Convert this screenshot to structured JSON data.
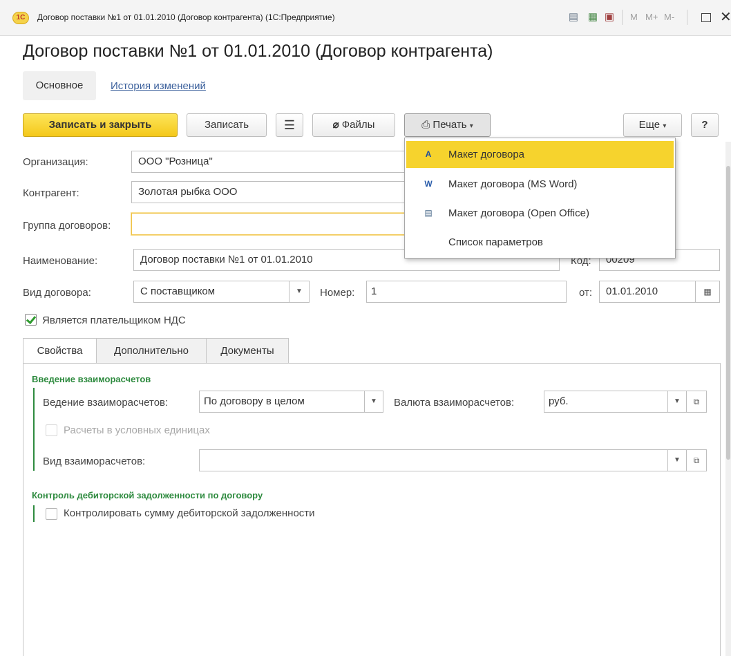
{
  "window": {
    "title": "Договор поставки №1 от 01.01.2010 (Договор контрагента)  (1С:Предприятие)",
    "toolbar_m": [
      "M",
      "M+",
      "M-"
    ]
  },
  "form": {
    "title": "Договор поставки №1 от 01.01.2010 (Договор контрагента)",
    "tabs": {
      "main": "Основное",
      "history": "История изменений"
    }
  },
  "toolbar": {
    "save_close": "Записать и закрыть",
    "save": "Записать",
    "files": "Файлы",
    "print": "Печать",
    "more": "Еще",
    "help": "?"
  },
  "print_menu": {
    "items": [
      {
        "label": "Макет договора",
        "icon": "word-doc-icon"
      },
      {
        "label": "Макет договора (MS Word)",
        "icon": "ms-word-icon"
      },
      {
        "label": "Макет договора (Open Office)",
        "icon": "open-office-icon"
      },
      {
        "label": "Список параметров",
        "icon": ""
      }
    ]
  },
  "fields": {
    "organization": {
      "label": "Организация:",
      "value": "ООО \"Розница\""
    },
    "counterparty": {
      "label": "Контрагент:",
      "value": "Золотая рыбка ООО"
    },
    "group": {
      "label": "Группа договоров:",
      "value": ""
    },
    "name": {
      "label": "Наименование:",
      "value": "Договор поставки №1 от 01.01.2010"
    },
    "code": {
      "label": "Код:",
      "value": "00209"
    },
    "contract_type": {
      "label": "Вид договора:",
      "value": "С поставщиком"
    },
    "number": {
      "label": "Номер:",
      "value": "1"
    },
    "date": {
      "label": "от:",
      "value": "01.01.2010"
    },
    "vat_payer": {
      "label": "Является плательщиком НДС",
      "checked": true
    }
  },
  "panel_tabs": [
    "Свойства",
    "Дополнительно",
    "Документы"
  ],
  "settlements": {
    "group_title": "Введение взаиморасчетов",
    "mode_label": "Ведение взаиморасчетов:",
    "mode_value": "По договору в целом",
    "currency_label": "Валюта взаиморасчетов:",
    "currency_value": "руб.",
    "conditional_units_label": "Расчеты в условных единицах",
    "type_label": "Вид взаиморасчетов:",
    "type_value": ""
  },
  "receivables": {
    "group_title": "Контроль дебиторской задолженности по договору",
    "control_label": "Контролировать сумму дебиторской задолженности"
  },
  "colors": {
    "accent": "#f6d32d",
    "group_green": "#2d8a3e",
    "link": "#3a5f9b"
  }
}
